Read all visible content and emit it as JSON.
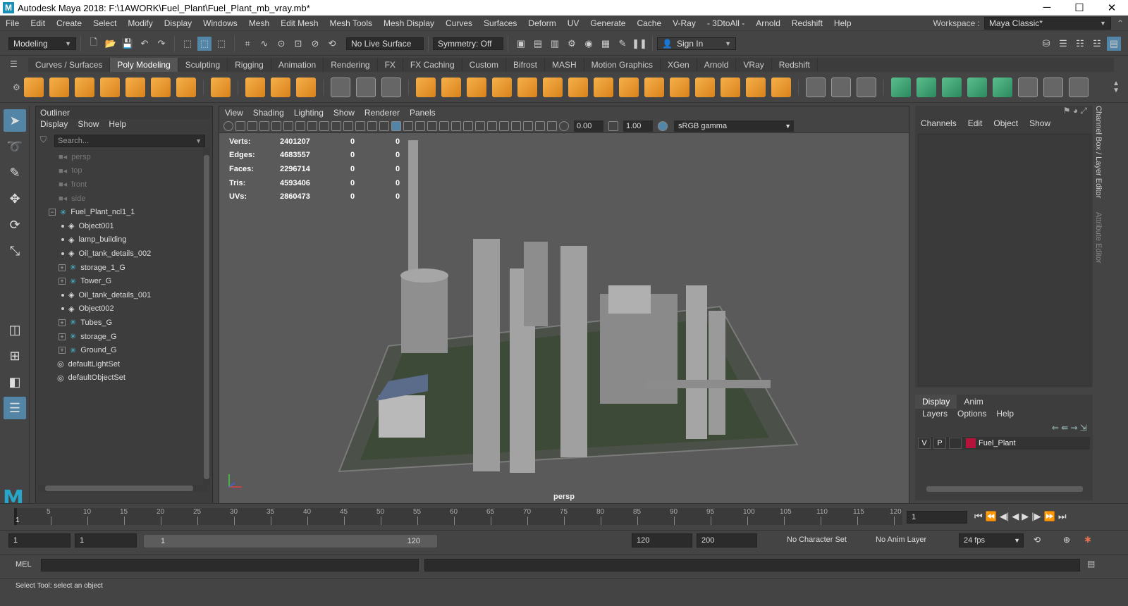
{
  "titlebar": {
    "title": "Autodesk Maya 2018: F:\\1AWORK\\Fuel_Plant\\Fuel_Plant_mb_vray.mb*",
    "minimize": "─",
    "maximize": "☐",
    "close": "✕"
  },
  "menubar": {
    "items": [
      "File",
      "Edit",
      "Create",
      "Select",
      "Modify",
      "Display",
      "Windows",
      "Mesh",
      "Edit Mesh",
      "Mesh Tools",
      "Mesh Display",
      "Curves",
      "Surfaces",
      "Deform",
      "UV",
      "Generate",
      "Cache",
      "V-Ray",
      "- 3DtoAll -",
      "Arnold",
      "Redshift",
      "Help"
    ],
    "workspace_label": "Workspace :",
    "workspace_value": "Maya Classic*"
  },
  "statusline": {
    "mode": "Modeling",
    "live_surface": "No Live Surface",
    "symmetry": "Symmetry: Off",
    "sign_in": "Sign In"
  },
  "shelf": {
    "tabs": [
      "Curves / Surfaces",
      "Poly Modeling",
      "Sculpting",
      "Rigging",
      "Animation",
      "Rendering",
      "FX",
      "FX Caching",
      "Custom",
      "Bifrost",
      "MASH",
      "Motion Graphics",
      "XGen",
      "Arnold",
      "VRay",
      "Redshift"
    ],
    "active_tab": "Poly Modeling"
  },
  "outliner": {
    "title": "Outliner",
    "menu": [
      "Display",
      "Show",
      "Help"
    ],
    "search_placeholder": "Search...",
    "items": [
      {
        "label": "persp",
        "kind": "camera"
      },
      {
        "label": "top",
        "kind": "camera"
      },
      {
        "label": "front",
        "kind": "camera"
      },
      {
        "label": "side",
        "kind": "camera"
      },
      {
        "label": "Fuel_Plant_ncl1_1",
        "kind": "group"
      },
      {
        "label": "Object001",
        "kind": "mesh"
      },
      {
        "label": "lamp_building",
        "kind": "mesh"
      },
      {
        "label": "Oil_tank_details_002",
        "kind": "mesh"
      },
      {
        "label": "storage_1_G",
        "kind": "group"
      },
      {
        "label": "Tower_G",
        "kind": "group"
      },
      {
        "label": "Oil_tank_details_001",
        "kind": "mesh"
      },
      {
        "label": "Object002",
        "kind": "mesh"
      },
      {
        "label": "Tubes_G",
        "kind": "group"
      },
      {
        "label": "storage_G",
        "kind": "group"
      },
      {
        "label": "Ground_G",
        "kind": "group"
      },
      {
        "label": "defaultLightSet",
        "kind": "set"
      },
      {
        "label": "defaultObjectSet",
        "kind": "set"
      }
    ]
  },
  "viewport": {
    "menu": [
      "View",
      "Shading",
      "Lighting",
      "Show",
      "Renderer",
      "Panels"
    ],
    "exposure": "0.00",
    "gamma": "1.00",
    "color_space": "sRGB gamma",
    "camera_label": "persp",
    "stats": [
      {
        "label": "Verts:",
        "value": "2401207",
        "sel": "0",
        "extra": "0"
      },
      {
        "label": "Edges:",
        "value": "4683557",
        "sel": "0",
        "extra": "0"
      },
      {
        "label": "Faces:",
        "value": "2296714",
        "sel": "0",
        "extra": "0"
      },
      {
        "label": "Tris:",
        "value": "4593406",
        "sel": "0",
        "extra": "0"
      },
      {
        "label": "UVs:",
        "value": "2860473",
        "sel": "0",
        "extra": "0"
      }
    ]
  },
  "channelbox": {
    "menu": [
      "Channels",
      "Edit",
      "Object",
      "Show"
    ],
    "side_tabs": [
      "Channel Box / Layer Editor",
      "Attribute Editor"
    ]
  },
  "layers": {
    "tabs": [
      "Display",
      "Anim"
    ],
    "menu": [
      "Layers",
      "Options",
      "Help"
    ],
    "layer": {
      "v": "V",
      "p": "P",
      "name": "Fuel_Plant",
      "color": "#b4143c"
    }
  },
  "timeline": {
    "ticks": [
      "5",
      "10",
      "15",
      "20",
      "25",
      "30",
      "35",
      "40",
      "45",
      "50",
      "55",
      "60",
      "65",
      "70",
      "75",
      "80",
      "85",
      "90",
      "95",
      "100",
      "105",
      "110",
      "115",
      "120"
    ],
    "current_marker": "1",
    "current_frame": "1"
  },
  "range": {
    "start": "1",
    "playback_start": "1",
    "slider_start": "1",
    "slider_end": "120",
    "playback_end": "120",
    "end": "200",
    "character_set": "No Character Set",
    "anim_layer": "No Anim Layer",
    "fps": "24 fps"
  },
  "mel": {
    "label": "MEL"
  },
  "helpline": {
    "text": "Select Tool: select an object"
  }
}
